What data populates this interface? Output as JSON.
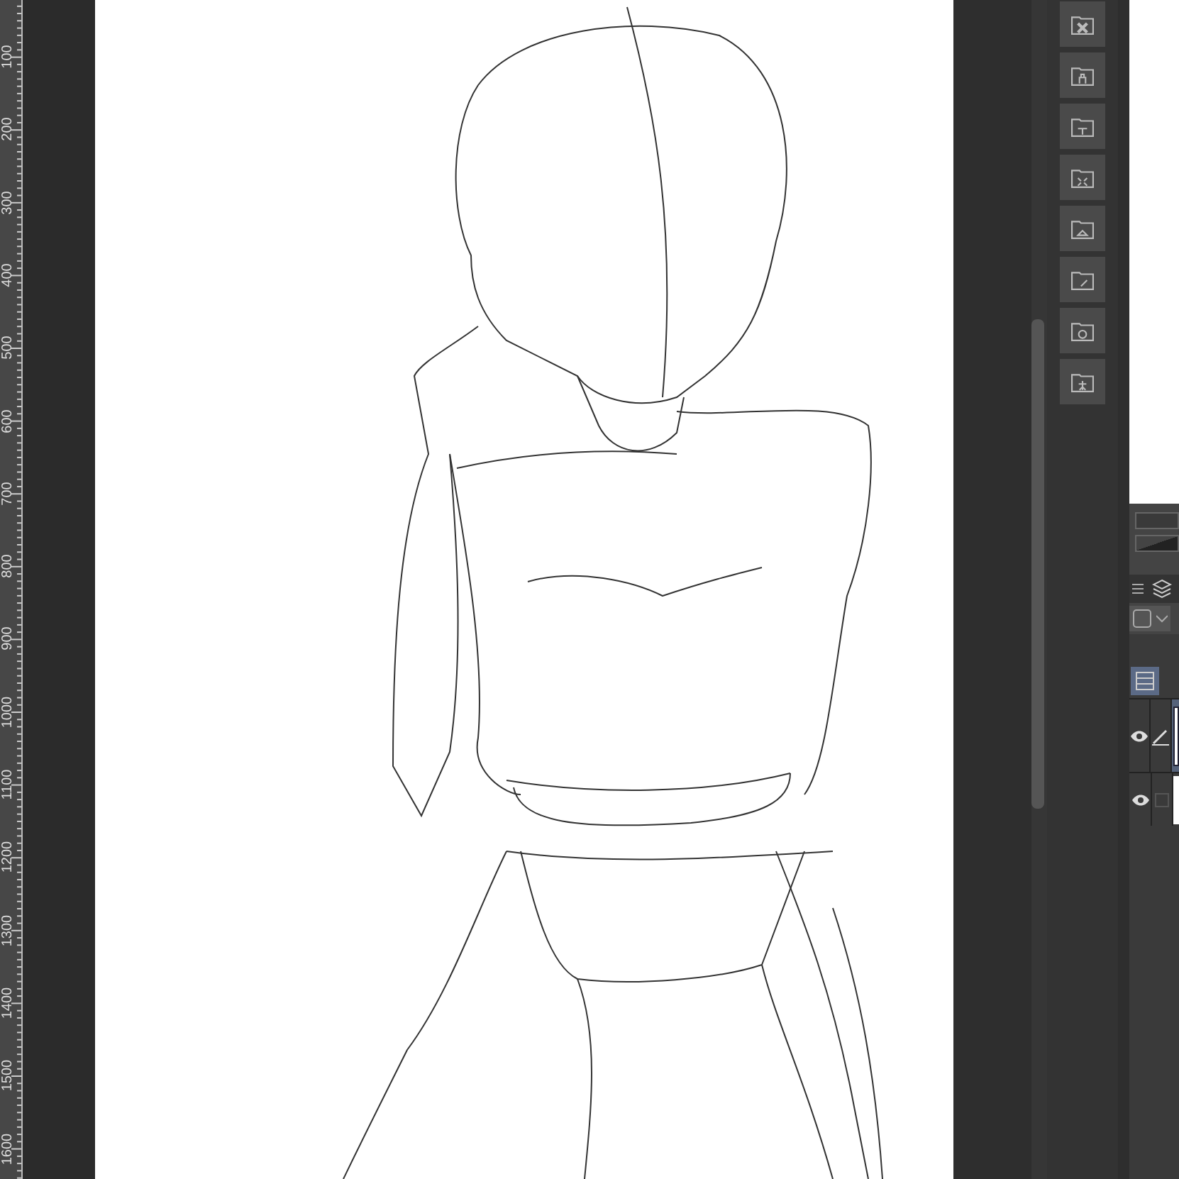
{
  "ruler": {
    "labels": [
      "100",
      "200",
      "300",
      "400",
      "500",
      "600",
      "700",
      "800",
      "900",
      "1000",
      "1100",
      "1200",
      "1300",
      "1400",
      "1500",
      "1600"
    ]
  },
  "layers": [
    {
      "visible": true,
      "selected": true
    },
    {
      "visible": true,
      "selected": false
    }
  ]
}
